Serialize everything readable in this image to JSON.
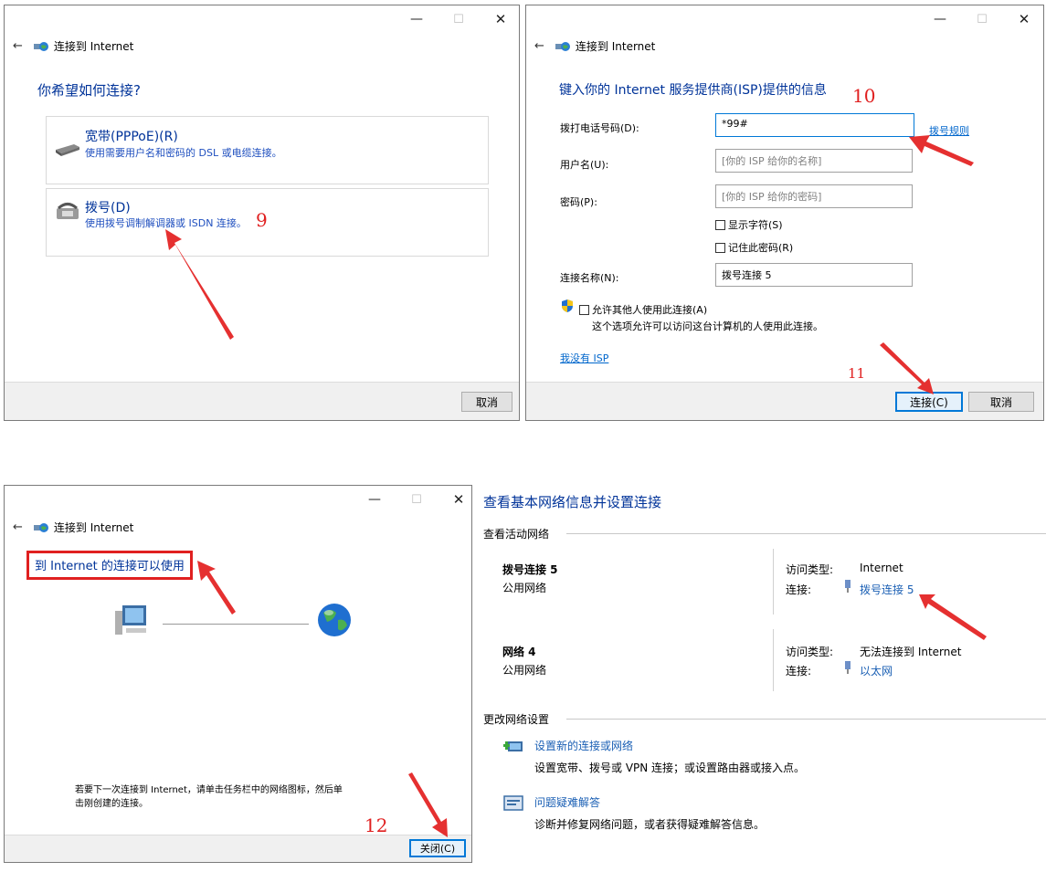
{
  "window_title": "连接到 Internet",
  "panel1": {
    "heading": "你希望如何连接?",
    "option_broadband": {
      "title": "宽带(PPPoE)(R)",
      "desc": "使用需要用户名和密码的 DSL 或电缆连接。"
    },
    "option_dialup": {
      "title": "拨号(D)",
      "desc": "使用拨号调制解调器或 ISDN 连接。"
    },
    "step_label": "9",
    "cancel_label": "取消"
  },
  "panel2": {
    "heading": "键入你的 Internet 服务提供商(ISP)提供的信息",
    "step_label": "10",
    "phone_label": "拨打电话号码(D):",
    "phone_value": "*99#",
    "dial_rules_link": "拨号规则",
    "username_label": "用户名(U):",
    "username_placeholder": "[你的 ISP 给你的名称]",
    "password_label": "密码(P):",
    "password_placeholder": "[你的 ISP 给你的密码]",
    "show_chars_label": "显示字符(S)",
    "remember_label": "记住此密码(R)",
    "conn_name_label": "连接名称(N):",
    "conn_name_value": "拨号连接 5",
    "allow_others_label": "允许其他人使用此连接(A)",
    "allow_others_desc": "这个选项允许可以访问这台计算机的人使用此连接。",
    "no_isp_link": "我没有 ISP",
    "step2_label": "11",
    "connect_label": "连接(C)",
    "cancel_label": "取消"
  },
  "panel3": {
    "status": "到 Internet 的连接可以使用",
    "hint_line1": "若要下一次连接到 Internet，请单击任务栏中的网络图标，然后单",
    "hint_line2": "击刚创建的连接。",
    "step_label": "12",
    "close_label": "关闭(C)"
  },
  "panel4": {
    "title": "查看基本网络信息并设置连接",
    "active_header": "查看活动网络",
    "networks": [
      {
        "name": "拨号连接 5",
        "type": "公用网络",
        "access_label": "访问类型:",
        "access_value": "Internet",
        "conn_label": "连接:",
        "conn_value": "拨号连接 5"
      },
      {
        "name": "网络  4",
        "type": "公用网络",
        "access_label": "访问类型:",
        "access_value": "无法连接到 Internet",
        "conn_label": "连接:",
        "conn_value": "以太网"
      }
    ],
    "change_header": "更改网络设置",
    "tasks": [
      {
        "title": "设置新的连接或网络",
        "desc": "设置宽带、拨号或 VPN 连接；或设置路由器或接入点。"
      },
      {
        "title": "问题疑难解答",
        "desc": "诊断并修复网络问题，或者获得疑难解答信息。"
      }
    ]
  },
  "colors": {
    "accent": "#0078d7",
    "link": "#1a5fb4",
    "annotation": "#e02020",
    "footer": "#f0f0f0"
  }
}
